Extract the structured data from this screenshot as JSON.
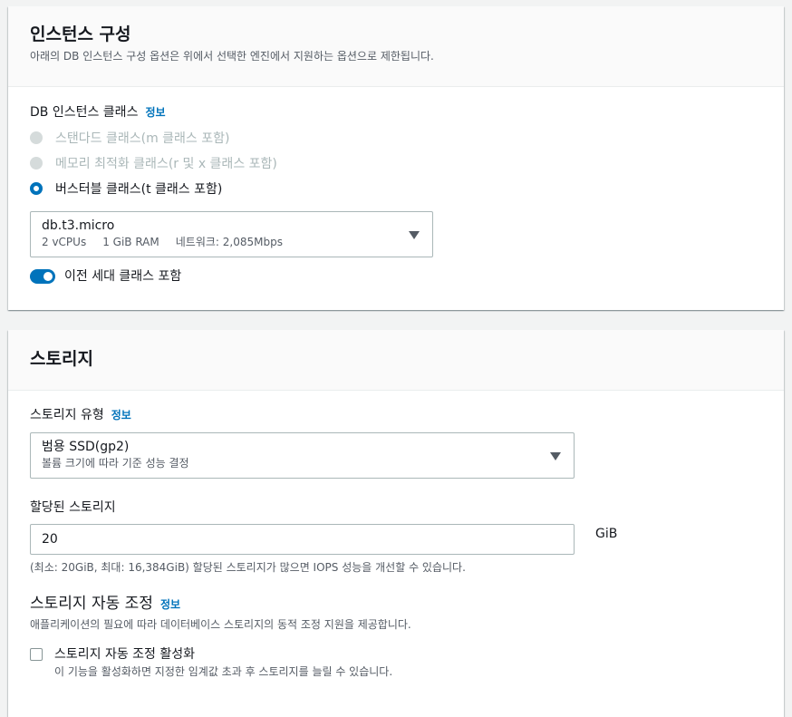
{
  "instance": {
    "title": "인스턴스 구성",
    "description": "아래의 DB 인스턴스 구성 옵션은 위에서 선택한 엔진에서 지원하는 옵션으로 제한됩니다.",
    "class_label": "DB 인스턴스 클래스",
    "info_label": "정보",
    "options": [
      {
        "label": "스탠다드 클래스(m 클래스 포함)",
        "state": "disabled"
      },
      {
        "label": "메모리 최적화 클래스(r 및 x 클래스 포함)",
        "state": "disabled"
      },
      {
        "label": "버스터블 클래스(t 클래스 포함)",
        "state": "selected"
      }
    ],
    "select": {
      "value": "db.t3.micro",
      "vcpu": "2 vCPUs",
      "ram": "1 GiB RAM",
      "network": "네트워크: 2,085Mbps"
    },
    "toggle_label": "이전 세대 클래스 포함",
    "toggle_on": true
  },
  "storage": {
    "title": "스토리지",
    "type_label": "스토리지 유형",
    "info_label": "정보",
    "type_select": {
      "value": "범용 SSD(gp2)",
      "sub": "볼륨 크기에 따라 기준 성능 결정"
    },
    "allocated_label": "할당된 스토리지",
    "allocated_value": "20",
    "unit": "GiB",
    "allocated_hint": "(최소: 20GiB, 최대: 16,384GiB) 할당된 스토리지가 많으면 IOPS 성능을 개선할 수 있습니다.",
    "autoscale_title": "스토리지 자동 조정",
    "autoscale_info": "정보",
    "autoscale_desc": "애플리케이션의 필요에 따라 데이터베이스 스토리지의 동적 조정 지원을 제공합니다.",
    "autoscale_checkbox_label": "스토리지 자동 조정 활성화",
    "autoscale_checkbox_desc": "이 기능을 활성화하면 지정한 임계값 초과 후 스토리지를 늘릴 수 있습니다.",
    "autoscale_checked": false
  },
  "colors": {
    "accent": "#0073bb",
    "background": "#f2f3f3",
    "disabled": "#aab7b8"
  }
}
